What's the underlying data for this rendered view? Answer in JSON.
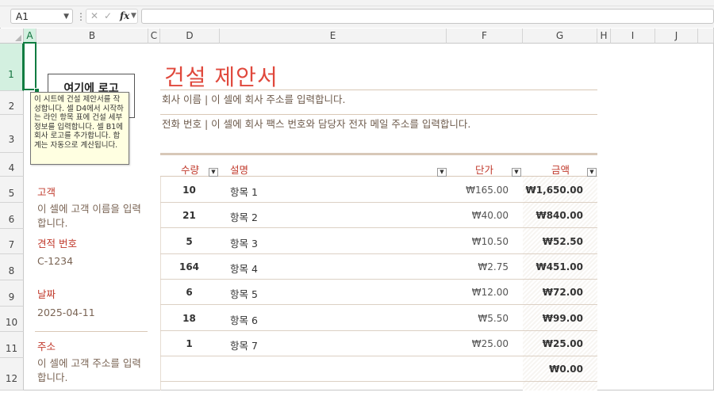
{
  "formula_bar": {
    "name_box": "A1",
    "fx_label": "fx",
    "cancel_icon": "✕",
    "enter_icon": "✓"
  },
  "columns": [
    {
      "label": "A"
    },
    {
      "label": "B"
    },
    {
      "label": "C"
    },
    {
      "label": "D"
    },
    {
      "label": "E"
    },
    {
      "label": "F"
    },
    {
      "label": "G"
    },
    {
      "label": "H"
    },
    {
      "label": "I"
    },
    {
      "label": "J"
    }
  ],
  "rows": [
    "1",
    "2",
    "3",
    "4",
    "5",
    "6",
    "7",
    "8",
    "9",
    "10",
    "11",
    "12"
  ],
  "logo_text": "여기에 로고",
  "tooltip_text": "이 시트에 건설 제안서를 작성합니다. 셀 D4에서 시작하는 라인 항목 표에 건설 세부 정보를 입력합니다. 셀 B1에 회사 로고를 추가합니다. 합계는 자동으로 계산됩니다.",
  "title": "건설 제안서",
  "company_line": "회사 이름     | 이 셀에 회사 주소를 입력합니다.",
  "phone_line": "전화 번호     | 이 셀에 회사 팩스 번호와 담당자 전자 메일 주소를 입력합니다.",
  "customer": {
    "label": "고객",
    "value": "이 셀에 고객 이름을 입력합니다."
  },
  "quote": {
    "label": "견적 번호",
    "value": "C-1234"
  },
  "date": {
    "label": "날짜",
    "value": "2025-04-11"
  },
  "address": {
    "label": "주소",
    "value": "이 셀에 고객 주소를 입력합니다."
  },
  "table": {
    "headers": {
      "qty": "수량",
      "desc": "설명",
      "price": "단가",
      "amount": "금액"
    },
    "rows": [
      {
        "qty": "10",
        "desc": "항목 1",
        "price": "₩165.00",
        "amount": "₩1,650.00"
      },
      {
        "qty": "21",
        "desc": "항목 2",
        "price": "₩40.00",
        "amount": "₩840.00"
      },
      {
        "qty": "5",
        "desc": "항목 3",
        "price": "₩10.50",
        "amount": "₩52.50"
      },
      {
        "qty": "164",
        "desc": "항목 4",
        "price": "₩2.75",
        "amount": "₩451.00"
      },
      {
        "qty": "6",
        "desc": "항목 5",
        "price": "₩12.00",
        "amount": "₩72.00"
      },
      {
        "qty": "18",
        "desc": "항목 6",
        "price": "₩5.50",
        "amount": "₩99.00"
      },
      {
        "qty": "1",
        "desc": "항목 7",
        "price": "₩25.00",
        "amount": "₩25.00"
      },
      {
        "qty": "",
        "desc": "",
        "price": "",
        "amount": "₩0.00"
      }
    ]
  }
}
